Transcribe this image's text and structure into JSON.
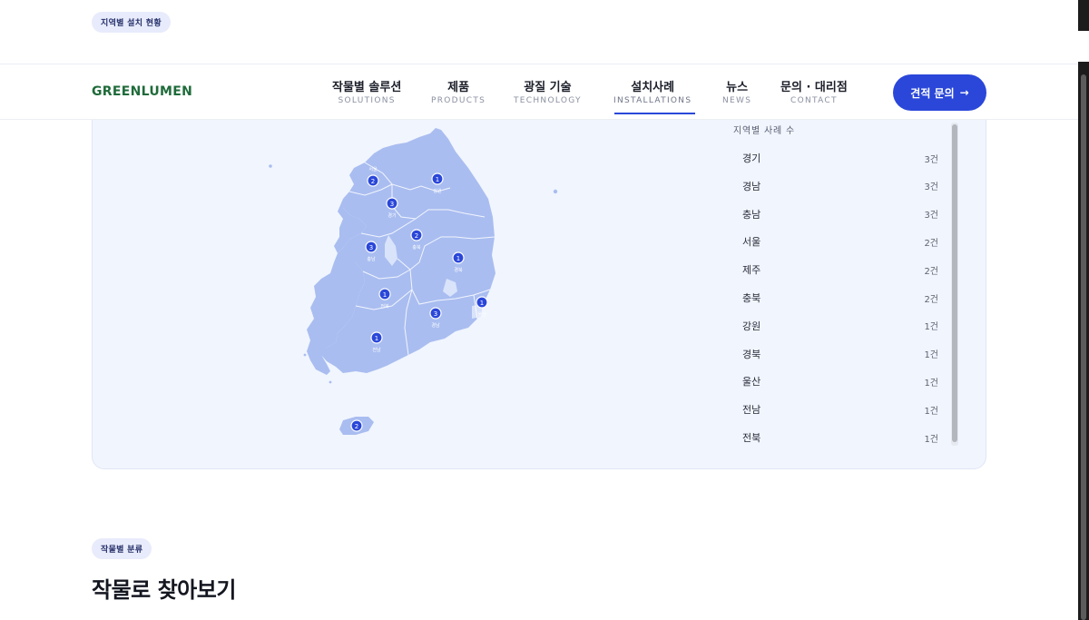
{
  "top_badge": "지역별 설치 현황",
  "nav": {
    "logo": "GREENLUMEN",
    "items": [
      {
        "ko": "작물별 솔루션",
        "en": "SOLUTIONS"
      },
      {
        "ko": "제품",
        "en": "PRODUCTS"
      },
      {
        "ko": "광질 기술",
        "en": "TECHNOLOGY"
      },
      {
        "ko": "설치사례",
        "en": "INSTALLATIONS"
      },
      {
        "ko": "뉴스",
        "en": "NEWS"
      },
      {
        "ko": "문의 · 대리점",
        "en": "CONTACT"
      }
    ],
    "active_index": 3,
    "cta_label": "견적 문의",
    "cta_arrow": "→"
  },
  "map": {
    "markers": [
      {
        "count": "2",
        "label": "서울"
      },
      {
        "count": "3",
        "label": "경기"
      },
      {
        "count": "1",
        "label": "강원"
      },
      {
        "count": "2",
        "label": "충북"
      },
      {
        "count": "3",
        "label": "충남"
      },
      {
        "count": "1",
        "label": "경북"
      },
      {
        "count": "1",
        "label": "전북"
      },
      {
        "count": "1",
        "label": "울산"
      },
      {
        "count": "3",
        "label": "경남"
      },
      {
        "count": "1",
        "label": "전남"
      },
      {
        "count": "2",
        "label": ""
      }
    ]
  },
  "stats": {
    "title": "지역별 사례 수",
    "rows": [
      {
        "name": "경기",
        "count": "3건"
      },
      {
        "name": "경남",
        "count": "3건"
      },
      {
        "name": "충남",
        "count": "3건"
      },
      {
        "name": "서울",
        "count": "2건"
      },
      {
        "name": "제주",
        "count": "2건"
      },
      {
        "name": "충북",
        "count": "2건"
      },
      {
        "name": "강원",
        "count": "1건"
      },
      {
        "name": "경북",
        "count": "1건"
      },
      {
        "name": "울산",
        "count": "1건"
      },
      {
        "name": "전남",
        "count": "1건"
      },
      {
        "name": "전북",
        "count": "1건"
      }
    ]
  },
  "section": {
    "badge": "작물별 분류",
    "title": "작물로 찾아보기"
  },
  "colors": {
    "accent": "#2a47d9",
    "brand": "#1f6b3a",
    "map_fill": "#a9bdf0",
    "card_bg": "#f1f5fe"
  }
}
